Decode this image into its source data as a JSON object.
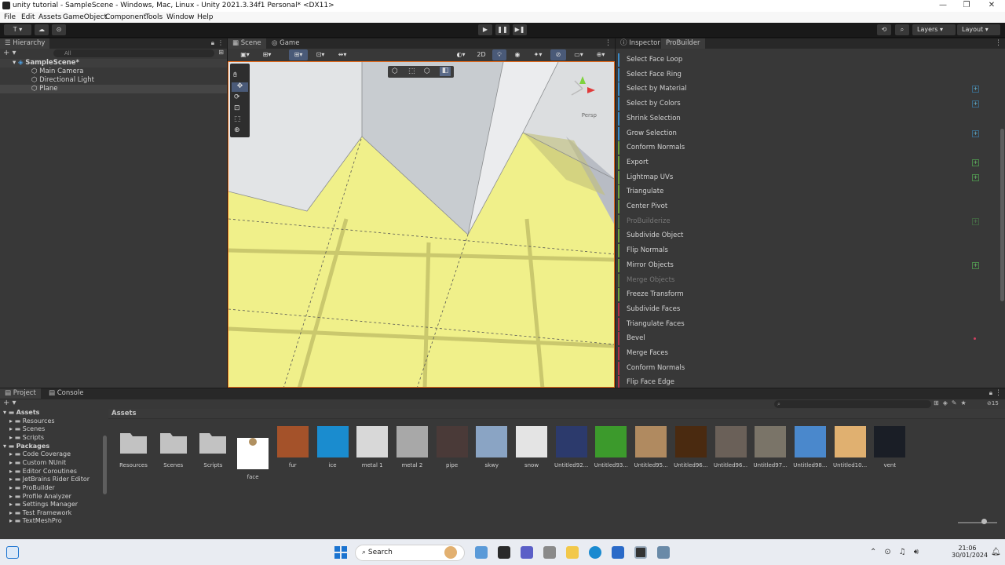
{
  "window": {
    "title": "unity tutorial - SampleScene - Windows, Mac, Linux - Unity 2021.3.34f1 Personal* <DX11>",
    "min": "—",
    "max": "❐",
    "close": "✕"
  },
  "menu": [
    "File",
    "Edit",
    "Assets",
    "GameObject",
    "Component",
    "Tools",
    "Window",
    "Help"
  ],
  "toolbar": {
    "account": "T ▾",
    "layers": "Layers",
    "layout": "Layout",
    "play": "▶",
    "pause": "❚❚",
    "step": "▶❚"
  },
  "hierarchy": {
    "tab": "Hierarchy",
    "search_placeholder": "All",
    "scene": "SampleScene*",
    "items": [
      "Main Camera",
      "Directional Light",
      "Plane"
    ]
  },
  "scene": {
    "tabs": [
      "Scene",
      "Game"
    ],
    "mode_2d": "2D",
    "persp": "Persp"
  },
  "inspector": {
    "tabs": [
      "Inspector",
      "ProBuilder"
    ],
    "items": [
      {
        "label": "Select Face Loop",
        "kind": "sel",
        "plus": false
      },
      {
        "label": "Select Face Ring",
        "kind": "sel",
        "plus": false
      },
      {
        "label": "Select by Material",
        "kind": "sel",
        "plus": true
      },
      {
        "label": "Select by Colors",
        "kind": "sel",
        "plus": true
      },
      {
        "label": "Shrink Selection",
        "kind": "sel",
        "plus": false
      },
      {
        "label": "Grow Selection",
        "kind": "sel",
        "plus": true
      },
      {
        "label": "Conform Normals",
        "kind": "obj",
        "plus": false
      },
      {
        "label": "Export",
        "kind": "obj",
        "plus": true
      },
      {
        "label": "Lightmap UVs",
        "kind": "obj",
        "plus": true
      },
      {
        "label": "Triangulate",
        "kind": "obj",
        "plus": false
      },
      {
        "label": "Center Pivot",
        "kind": "obj",
        "plus": false
      },
      {
        "label": "ProBuilderize",
        "kind": "dis",
        "plus": true
      },
      {
        "label": "Subdivide Object",
        "kind": "obj",
        "plus": false
      },
      {
        "label": "Flip Normals",
        "kind": "obj",
        "plus": false
      },
      {
        "label": "Mirror Objects",
        "kind": "obj",
        "plus": true
      },
      {
        "label": "Merge Objects",
        "kind": "dis",
        "plus": false
      },
      {
        "label": "Freeze Transform",
        "kind": "obj",
        "plus": false
      },
      {
        "label": "Subdivide Faces",
        "kind": "face",
        "plus": false
      },
      {
        "label": "Triangulate Faces",
        "kind": "face",
        "plus": false
      },
      {
        "label": "Bevel",
        "kind": "face",
        "plus": false
      },
      {
        "label": "Merge Faces",
        "kind": "face",
        "plus": false
      },
      {
        "label": "Conform Normals",
        "kind": "face",
        "plus": false
      },
      {
        "label": "Flip Face Edge",
        "kind": "face",
        "plus": false
      }
    ]
  },
  "project": {
    "tabs": [
      "Project",
      "Console"
    ],
    "breadcrumb": "Assets",
    "count": "15",
    "tree": [
      {
        "label": "Assets",
        "level": 0,
        "bold": true
      },
      {
        "label": "Resources",
        "level": 1
      },
      {
        "label": "Scenes",
        "level": 1
      },
      {
        "label": "Scripts",
        "level": 1
      },
      {
        "label": "Packages",
        "level": 0,
        "bold": true
      },
      {
        "label": "Code Coverage",
        "level": 1
      },
      {
        "label": "Custom NUnit",
        "level": 1
      },
      {
        "label": "Editor Coroutines",
        "level": 1
      },
      {
        "label": "JetBrains Rider Editor",
        "level": 1
      },
      {
        "label": "ProBuilder",
        "level": 1
      },
      {
        "label": "Profile Analyzer",
        "level": 1
      },
      {
        "label": "Settings Manager",
        "level": 1
      },
      {
        "label": "Test Framework",
        "level": 1
      },
      {
        "label": "TextMeshPro",
        "level": 1
      }
    ],
    "assets": [
      {
        "label": "Resources",
        "type": "folder"
      },
      {
        "label": "Scenes",
        "type": "folder"
      },
      {
        "label": "Scripts",
        "type": "folder"
      },
      {
        "label": "face",
        "color": "#ffffff"
      },
      {
        "label": "fur",
        "color": "#a4522a"
      },
      {
        "label": "ice",
        "color": "#1a8ccf"
      },
      {
        "label": "metal 1",
        "color": "#d8d8d8"
      },
      {
        "label": "metal 2",
        "color": "#a8a8a8"
      },
      {
        "label": "pipe",
        "color": "#4a3a38"
      },
      {
        "label": "skwy",
        "color": "#8aa4c4"
      },
      {
        "label": "snow",
        "color": "#e4e4e4"
      },
      {
        "label": "Untitled92...",
        "color": "#2c3a6c"
      },
      {
        "label": "Untitled93...",
        "color": "#3c9a2c"
      },
      {
        "label": "Untitled95...",
        "color": "#b08a60"
      },
      {
        "label": "Untitled96...",
        "color": "#4a2a10"
      },
      {
        "label": "Untitled96...",
        "color": "#6a6058"
      },
      {
        "label": "Untitled97...",
        "color": "#7a7468"
      },
      {
        "label": "Untitled98...",
        "color": "#4a88cc"
      },
      {
        "label": "Untitled10...",
        "color": "#e0b070"
      },
      {
        "label": "vent",
        "color": "#1a1e26"
      }
    ]
  },
  "taskbar": {
    "search": "Search",
    "time": "21:06",
    "date": "30/01/2024"
  }
}
